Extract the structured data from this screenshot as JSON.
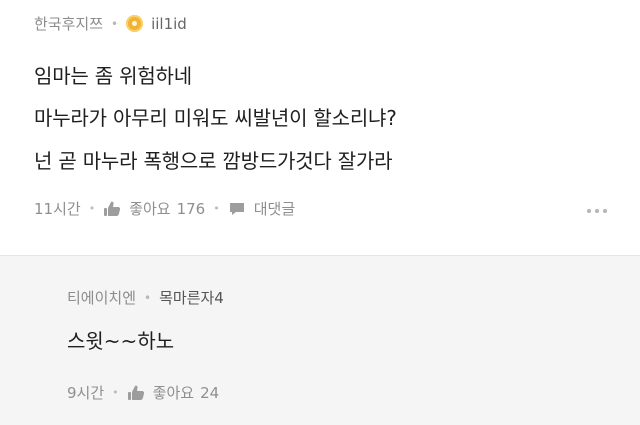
{
  "comment": {
    "author": "한국후지쯔",
    "user_level_name": "iil1id",
    "lines": [
      "임마는 좀 위험하네",
      "마누라가 아무리 미워도 씨발년이 할소리냐?",
      "넌 곧 마누라 폭행으로 깜방드가것다 잘가라"
    ],
    "time": "11시간",
    "like_label": "좋아요",
    "like_count": "176",
    "reply_label": "대댓글"
  },
  "reply": {
    "author": "티에이치엔",
    "target": "목마른자4",
    "text": "스윗~~하노",
    "time": "9시간",
    "like_label": "좋아요",
    "like_count": "24"
  },
  "colors": {
    "background": "#ffffff",
    "reply_background": "#f5f5f5",
    "medal": "#f2b233",
    "muted_text": "#8f8f8f"
  },
  "icons": {
    "medal": "medal-icon",
    "thumb": "thumb-up-icon",
    "reply": "reply-bubble-icon",
    "more": "more-options-icon"
  }
}
